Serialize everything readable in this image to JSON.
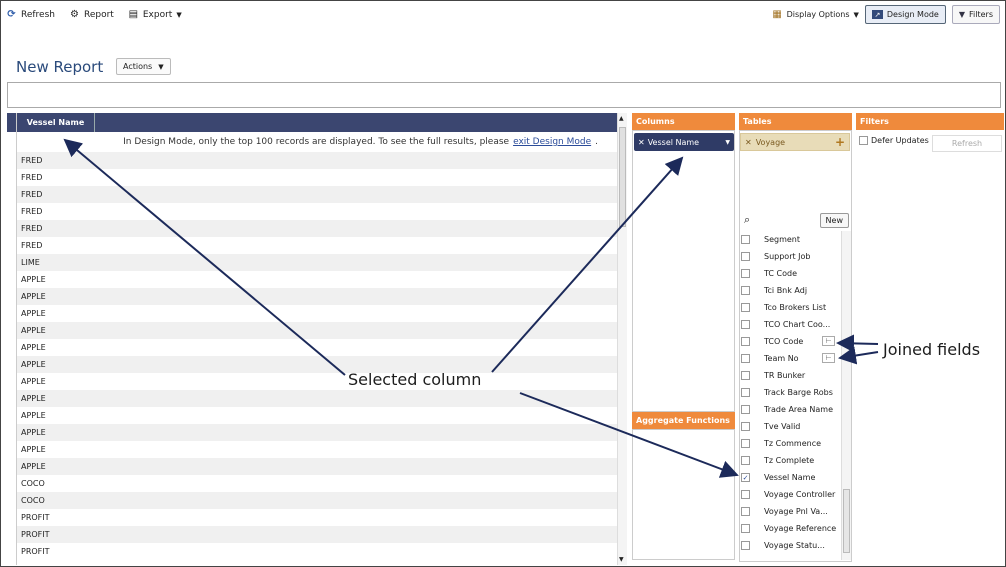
{
  "toolbar": {
    "refresh": "Refresh",
    "report": "Report",
    "export": "Export",
    "display_options": "Display Options",
    "design_mode": "Design Mode",
    "filters": "Filters"
  },
  "page_title": "New Report",
  "actions_label": "Actions",
  "grid": {
    "column_header": "Vessel Name",
    "notice_text": "In Design Mode, only the top 100 records are displayed. To see the full results, please",
    "notice_link": "exit Design Mode",
    "notice_end": ".",
    "rows": [
      "FRED",
      "FRED",
      "FRED",
      "FRED",
      "FRED",
      "FRED",
      "LIME",
      "APPLE",
      "APPLE",
      "APPLE",
      "APPLE",
      "APPLE",
      "APPLE",
      "APPLE",
      "APPLE",
      "APPLE",
      "APPLE",
      "APPLE",
      "APPLE",
      "COCO",
      "COCO",
      "PROFIT",
      "PROFIT",
      "PROFIT"
    ]
  },
  "panels": {
    "columns_title": "Columns",
    "aggregate_title": "Aggregate Functions",
    "tables_title": "Tables",
    "filters_title": "Filters",
    "selected_column": "Vessel Name",
    "selected_table": "Voyage",
    "defer_updates": "Defer Updates",
    "refresh": "Refresh",
    "new_button": "New"
  },
  "fields": [
    {
      "label": "Segment",
      "checked": false,
      "joined": false
    },
    {
      "label": "Support Job",
      "checked": false,
      "joined": false
    },
    {
      "label": "TC Code",
      "checked": false,
      "joined": false
    },
    {
      "label": "Tci Bnk Adj",
      "checked": false,
      "joined": false
    },
    {
      "label": "Tco Brokers List",
      "checked": false,
      "joined": false
    },
    {
      "label": "TCO Chart Coo...",
      "checked": false,
      "joined": false
    },
    {
      "label": "TCO Code",
      "checked": false,
      "joined": true
    },
    {
      "label": "Team No",
      "checked": false,
      "joined": true
    },
    {
      "label": "TR Bunker",
      "checked": false,
      "joined": false
    },
    {
      "label": "Track Barge Robs",
      "checked": false,
      "joined": false
    },
    {
      "label": "Trade Area Name",
      "checked": false,
      "joined": false
    },
    {
      "label": "Tve Valid",
      "checked": false,
      "joined": false
    },
    {
      "label": "Tz Commence",
      "checked": false,
      "joined": false
    },
    {
      "label": "Tz Complete",
      "checked": false,
      "joined": false
    },
    {
      "label": "Vessel Name",
      "checked": true,
      "joined": false
    },
    {
      "label": "Voyage Controller",
      "checked": false,
      "joined": false
    },
    {
      "label": "Voyage Pnl Va...",
      "checked": false,
      "joined": false
    },
    {
      "label": "Voyage Reference",
      "checked": false,
      "joined": false
    },
    {
      "label": "Voyage Statu...",
      "checked": false,
      "joined": false
    }
  ],
  "annotations": {
    "selected_column": "Selected column",
    "joined_fields": "Joined fields"
  },
  "colors": {
    "header_navy": "#3b4670",
    "panel_orange": "#ef8a3c",
    "chip_tan": "#e8dcb8"
  }
}
